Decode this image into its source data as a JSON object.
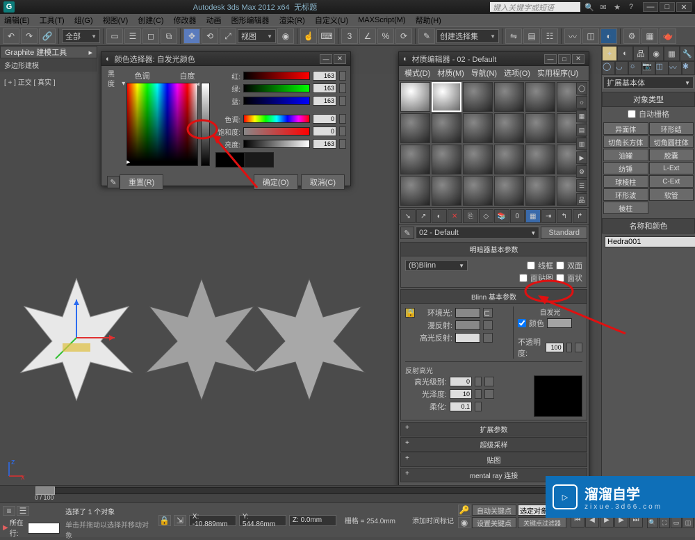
{
  "title": {
    "app": "Autodesk 3ds Max  2012  x64",
    "doc": "无标题"
  },
  "search_placeholder": "键入关键字或短语",
  "menu": [
    "编辑(E)",
    "工具(T)",
    "组(G)",
    "视图(V)",
    "创建(C)",
    "修改器",
    "动画",
    "图形编辑器",
    "渲染(R)",
    "自定义(U)",
    "MAXScript(M)",
    "帮助(H)"
  ],
  "toolbar": {
    "mode": "全部",
    "view": "视图",
    "selection": "创建选择集"
  },
  "graphite": {
    "title": "Graphite 建模工具",
    "sub": "多边形建模"
  },
  "viewport_label": "[ + ] 正交 [ 真实 ]",
  "color_dlg": {
    "title": "颜色选择器: 自发光颜色",
    "hue": "色调",
    "whiteness": "白度",
    "blackness": "黑度",
    "r": "红:",
    "g": "绿:",
    "b": "蓝:",
    "h": "色调:",
    "s": "饱和度:",
    "v": "亮度:",
    "rv": "163",
    "gv": "163",
    "bv": "163",
    "hv": "0",
    "sv": "0",
    "vv": "163",
    "reset": "重置(R)",
    "ok": "确定(O)",
    "cancel": "取消(C)"
  },
  "mat_dlg": {
    "title": "材质编辑器 - 02 - Default",
    "menu": [
      "模式(D)",
      "材质(M)",
      "导航(N)",
      "选项(O)",
      "实用程序(U)"
    ],
    "name": "02 - Default",
    "type": "Standard",
    "shader_roll": "明暗器基本参数",
    "shader": "(B)Blinn",
    "wire": "线框",
    "twoside": "双面",
    "facemap": "面贴图",
    "faceted": "面状",
    "blinn_roll": "Blinn 基本参数",
    "ambient": "环境光:",
    "diffuse": "漫反射:",
    "specular": "高光反射:",
    "selfillum": "自发光",
    "color": "颜色",
    "opacity": "不透明度:",
    "opv": "100",
    "spec_hdr": "反射高光",
    "spec_level": "高光级别:",
    "glossiness": "光泽度:",
    "soften": "柔化:",
    "slv": "0",
    "glv": "10",
    "sfv": "0.1",
    "rolls": [
      "扩展参数",
      "超级采样",
      "贴图",
      "mental ray 连接"
    ]
  },
  "cmd": {
    "dropdown": "扩展基本体",
    "autogrid": "自动栅格",
    "obj_title": "对象类型",
    "objects": [
      "异面体",
      "环形结",
      "切角长方体",
      "切角圆柱体",
      "油罐",
      "胶囊",
      "纺锤",
      "L-Ext",
      "球棱柱",
      "C-Ext",
      "环形波",
      "软管",
      "棱柱"
    ],
    "name_title": "名称和颜色",
    "obj_name": "Hedra001"
  },
  "status": {
    "sel": "选择了 1 个对象",
    "hint": "单击并拖动以选择并移动对象",
    "x": "X: -10.889mm",
    "y": "Y: 544.86mm",
    "z": "Z: 0.0mm",
    "grid": "栅格 = 254.0mm",
    "autokey": "自动关键点",
    "selkey": "选定对象",
    "setkey": "设置关键点",
    "keyfilter": "关键点过滤器",
    "addtime": "添加时间标记",
    "noloc": "所在行:",
    "timeline": "0 / 100"
  },
  "watermark": {
    "big": "溜溜自学",
    "small": "zixue.3d66.com"
  }
}
